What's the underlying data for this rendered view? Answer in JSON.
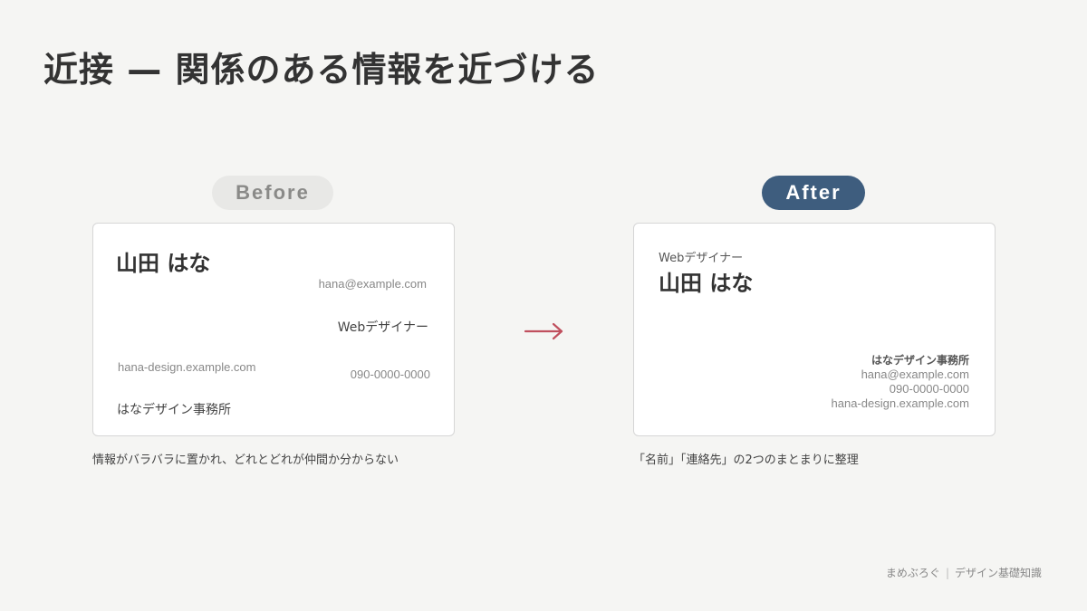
{
  "slide": {
    "title": "近接 — 関係のある情報を近づける"
  },
  "before": {
    "label": "Before",
    "card": {
      "name": "山田 はな",
      "email": "hana@example.com",
      "role": "Webデザイナー",
      "website": "hana-design.example.com",
      "phone": "090-0000-0000",
      "office": "はなデザイン事務所"
    },
    "caption": "情報がバラバラに置かれ、どれとどれが仲間か分からない"
  },
  "after": {
    "label": "After",
    "card": {
      "role": "Webデザイナー",
      "name": "山田 はな",
      "office": "はなデザイン事務所",
      "email": "hana@example.com",
      "phone": "090-0000-0000",
      "website": "hana-design.example.com"
    },
    "caption": "「名前」「連絡先」の2つのまとまりに整理"
  },
  "arrow": {
    "icon": "right-arrow-icon",
    "color": "#c0505e"
  },
  "footer": {
    "brand": "まめぶろぐ",
    "separator": "|",
    "series": "デザイン基礎知識"
  },
  "colors": {
    "background": "#f5f5f3",
    "after_accent": "#3e5d7e",
    "before_pill": "#e8e8e6"
  }
}
